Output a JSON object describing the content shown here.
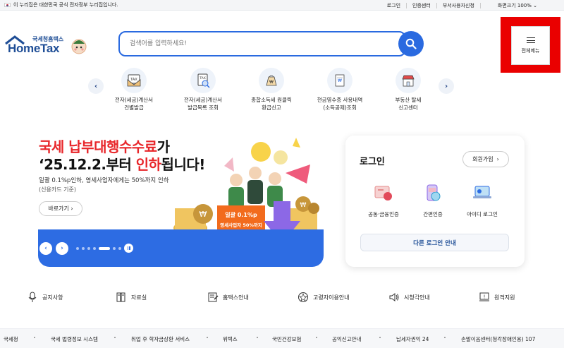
{
  "gov_banner": {
    "text": "이 누리집은 대한민국 공식 전자정부 누리집입니다.",
    "links": [
      "로그인",
      "인증센터",
      "부서사용자신청",
      "화면크기 100%"
    ]
  },
  "logo": {
    "small_text": "국세청홈택스",
    "brand": "HomeTax"
  },
  "search": {
    "placeholder": "검색어를 입력하세요!"
  },
  "full_menu": {
    "label": "전체메뉴"
  },
  "quick_menu": [
    {
      "line1": "전자(세금)계산서",
      "line2": "건별발급",
      "icon": "invoice-tax-icon"
    },
    {
      "line1": "전자(세금)계산서",
      "line2": "발급목록 조회",
      "icon": "invoice-list-icon"
    },
    {
      "line1": "종합소득세 원클릭",
      "line2": "환급신고",
      "icon": "refund-bag-icon"
    },
    {
      "line1": "현금영수증 사용내역",
      "line2": "(소득공제)조회",
      "icon": "receipt-icon"
    },
    {
      "line1": "부동산 탈세",
      "line2": "신고센터",
      "icon": "store-icon"
    }
  ],
  "hero": {
    "title1_red": "국세 납부대행수수료",
    "title1_rest": "가",
    "title2_pre": "‘25.12.2.부터 ",
    "title2_red": "인하",
    "title2_post": "됩니다!",
    "sub1": "일괄 0.1%p인하, 영세사업자에게는 50%까지 인하",
    "sub2": "(신용카드 기준)",
    "more": "바로가기",
    "sign_line1": "일괄 0.1%p",
    "sign_line2": "영세사업자 50%까지",
    "coin_symbol": "₩"
  },
  "carousel": {
    "prev": "‹",
    "next": "›"
  },
  "login": {
    "title": "로그인",
    "join": "회원가입",
    "options": [
      "공동·금융인증",
      "간편인증",
      "아이디 로그인"
    ],
    "other": "다른 로그인 안내"
  },
  "bottom_links": [
    {
      "label": "공지사항",
      "icon": "microphone-icon"
    },
    {
      "label": "자료실",
      "icon": "archive-icon"
    },
    {
      "label": "홈택스안내",
      "icon": "guide-icon"
    },
    {
      "label": "고령자이용안내",
      "icon": "senior-icon"
    },
    {
      "label": "시청각안내",
      "icon": "speaker-icon"
    },
    {
      "label": "원격지원",
      "icon": "remote-icon"
    }
  ],
  "sites": [
    "국세청",
    "국세 법령정보 시스템",
    "취업 후 학자금상환 서비스",
    "위택스",
    "국민건강보험",
    "공익신고안내",
    "납세자권익 24",
    "손말이음센터(청각장애인용) 107"
  ],
  "colors": {
    "primary": "#2d6ce3",
    "brand": "#1f4e96",
    "accent_red": "#e8262a",
    "highlight": "#ea0000"
  }
}
